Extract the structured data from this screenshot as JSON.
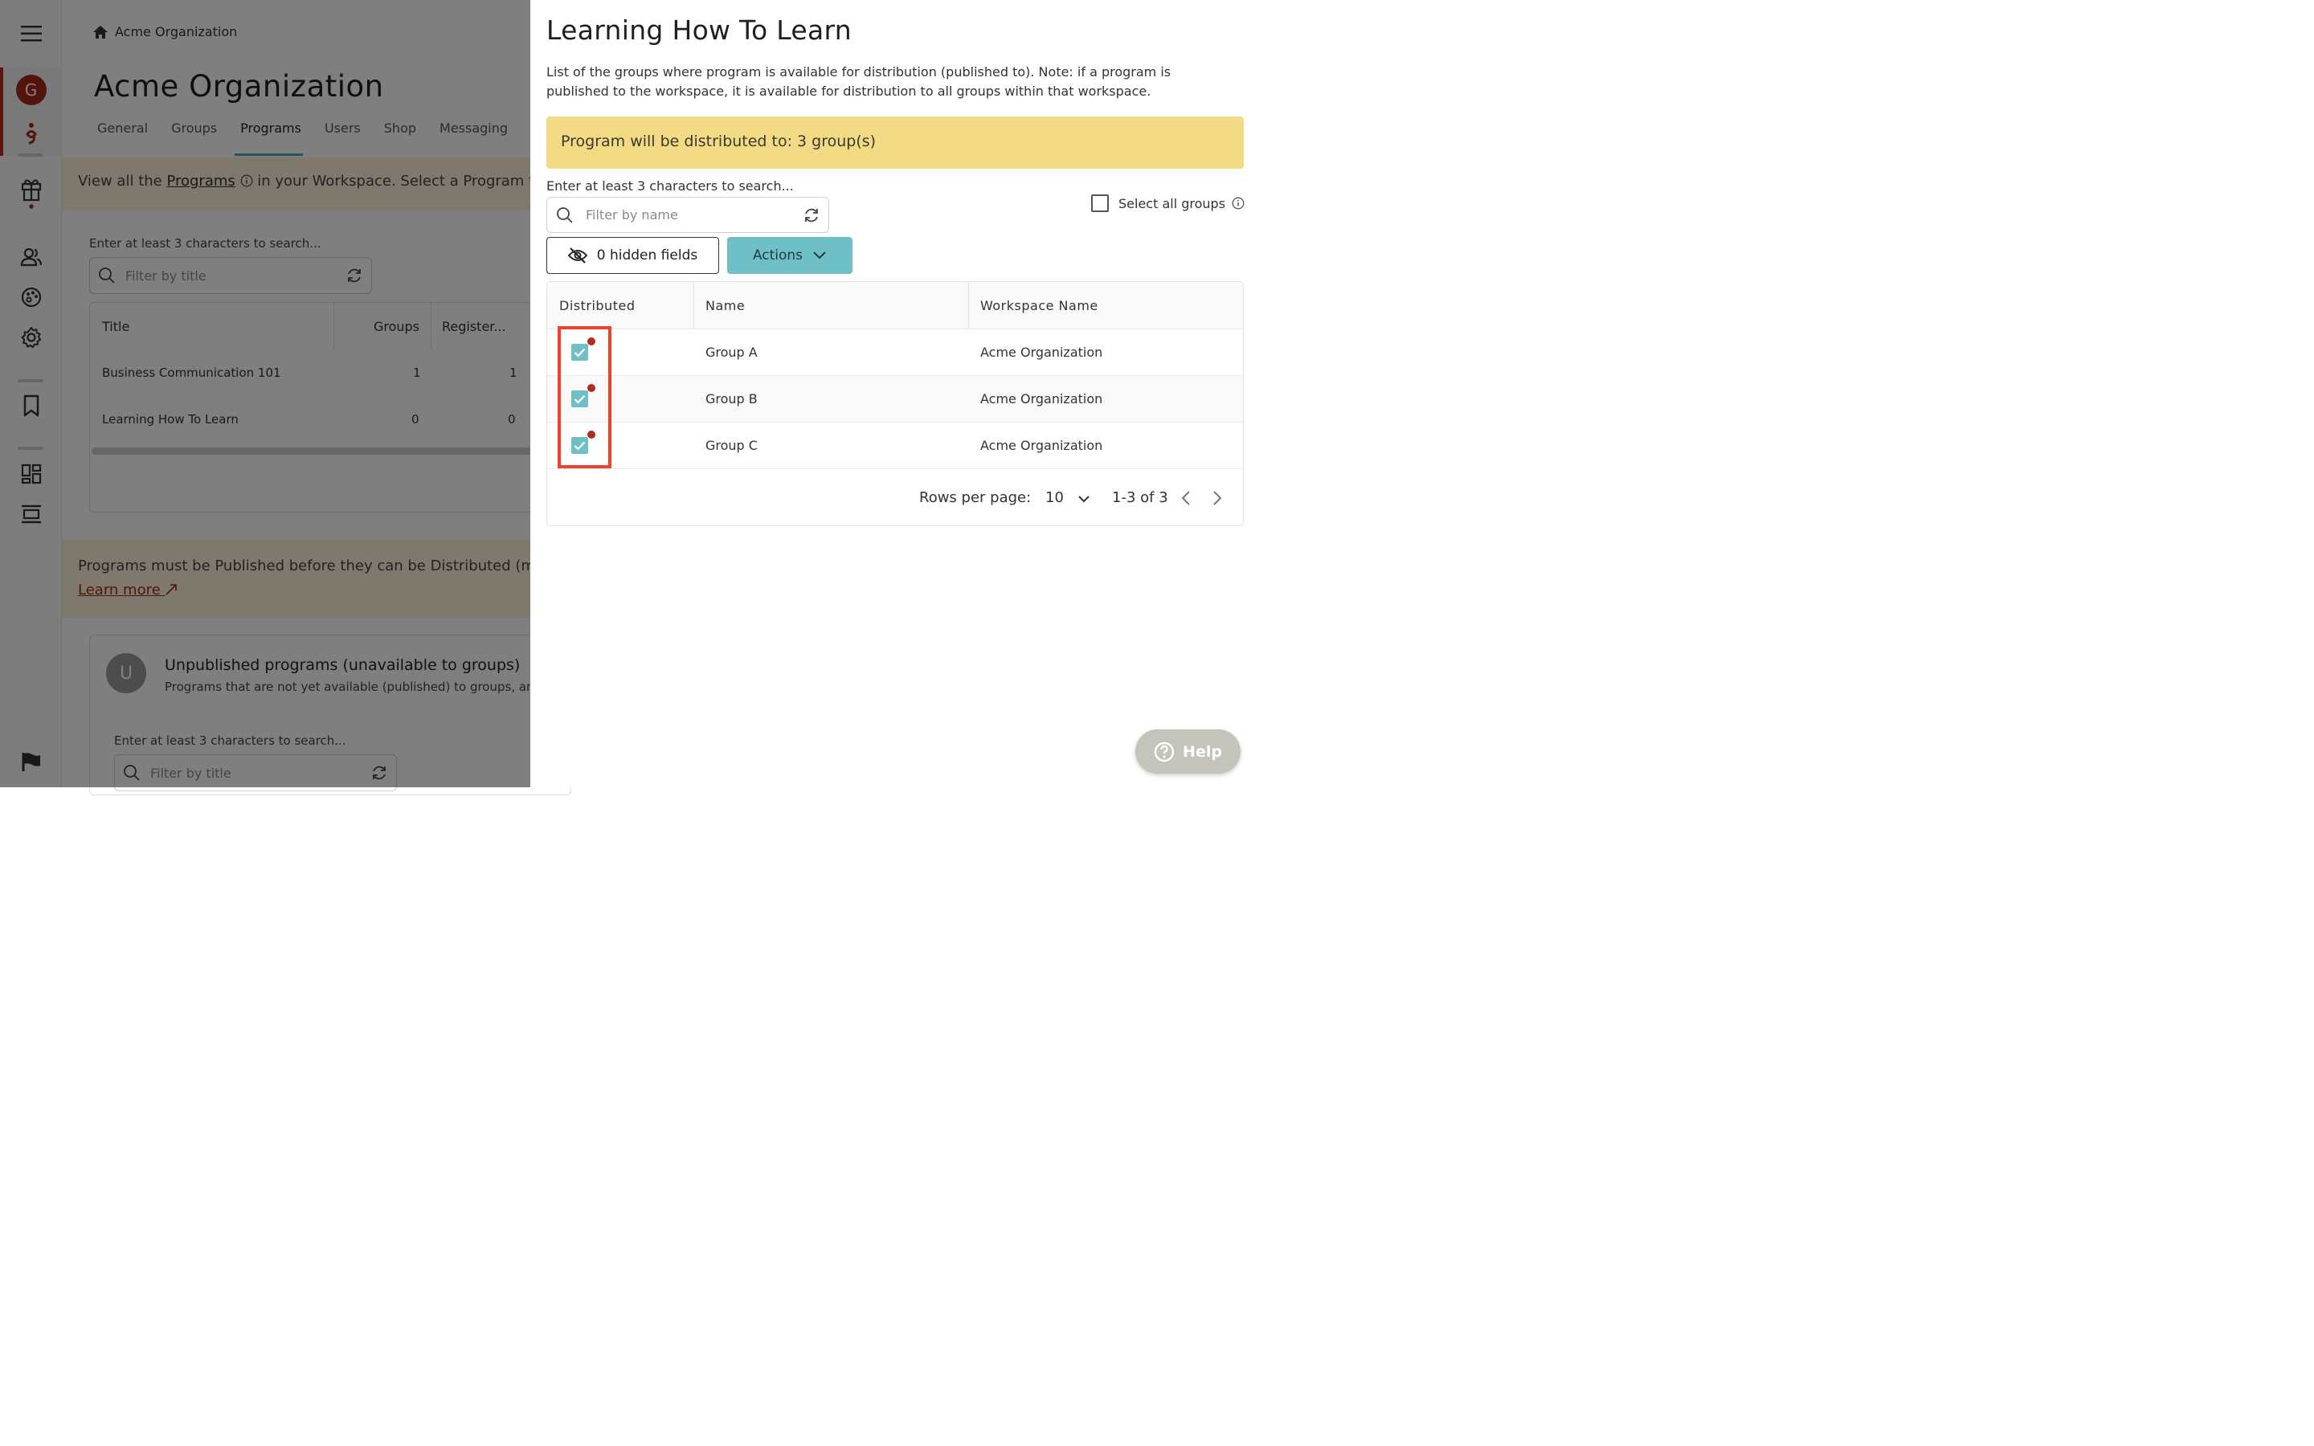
{
  "breadcrumb": {
    "org": "Acme Organization"
  },
  "org_header": {
    "title": "Acme Organization"
  },
  "tabs": [
    "General",
    "Groups",
    "Programs",
    "Users",
    "Shop",
    "Messaging"
  ],
  "active_tab": "Programs",
  "rail": {
    "avatar_letter": "G"
  },
  "info_banner": {
    "prefix": "View all the ",
    "link": "Programs",
    "suffix": " in your Workspace. Select a Program to"
  },
  "programs_search": {
    "hint": "Enter at least 3 characters to search...",
    "placeholder": "Filter by title"
  },
  "programs_table": {
    "columns": [
      "Title",
      "Groups",
      "Register..."
    ],
    "rows": [
      {
        "title": "Business Communication 101",
        "groups": "1",
        "registered": "1"
      },
      {
        "title": "Learning How To Learn",
        "groups": "0",
        "registered": "0"
      }
    ]
  },
  "publish_banner": {
    "text": "Programs must be Published before they can be Distributed (ma",
    "link": "Learn more"
  },
  "unpublished": {
    "avatar_letter": "U",
    "title": "Unpublished programs (unavailable to groups)",
    "subtitle": "Programs that are not yet available (published) to groups, and c",
    "search_hint": "Enter at least 3 characters to search...",
    "placeholder": "Filter by title"
  },
  "drawer": {
    "title": "Learning How To Learn",
    "description": "List of the groups where program is available for distribution (published to). Note: if a program is published to the workspace, it is available for distribution to all groups within that workspace.",
    "distribution_banner": "Program will be distributed to: 3 group(s)",
    "search_hint": "Enter at least 3 characters to search...",
    "filter_placeholder": "Filter by name",
    "select_all_label": "Select all groups",
    "hidden_fields_label": "0 hidden fields",
    "actions_label": "Actions",
    "columns": [
      "Distributed",
      "Name",
      "Workspace Name"
    ],
    "rows": [
      {
        "name": "Group A",
        "workspace": "Acme Organization",
        "distributed": true
      },
      {
        "name": "Group B",
        "workspace": "Acme Organization",
        "distributed": true
      },
      {
        "name": "Group C",
        "workspace": "Acme Organization",
        "distributed": true
      }
    ],
    "pagination": {
      "rows_label": "Rows per page:",
      "rows_value": "10",
      "range": "1-3 of 3"
    }
  },
  "help_button": {
    "label": "Help"
  },
  "colors": {
    "brand_red": "#b32a1f",
    "teal": "#6fc0c6",
    "banner_yellow": "#f3db86",
    "highlight_red": "#e8442f"
  },
  "icons": [
    "menu-icon",
    "home-icon",
    "gift-icon",
    "users-icon",
    "palette-icon",
    "gear-icon",
    "bookmark-icon",
    "dashboard-icon",
    "layout-icon",
    "flag-icon",
    "search-icon",
    "refresh-icon",
    "info-icon",
    "eye-off-icon",
    "chevron-down-icon",
    "chevron-left-icon",
    "chevron-right-icon",
    "check-icon",
    "help-icon",
    "external-link-icon"
  ]
}
